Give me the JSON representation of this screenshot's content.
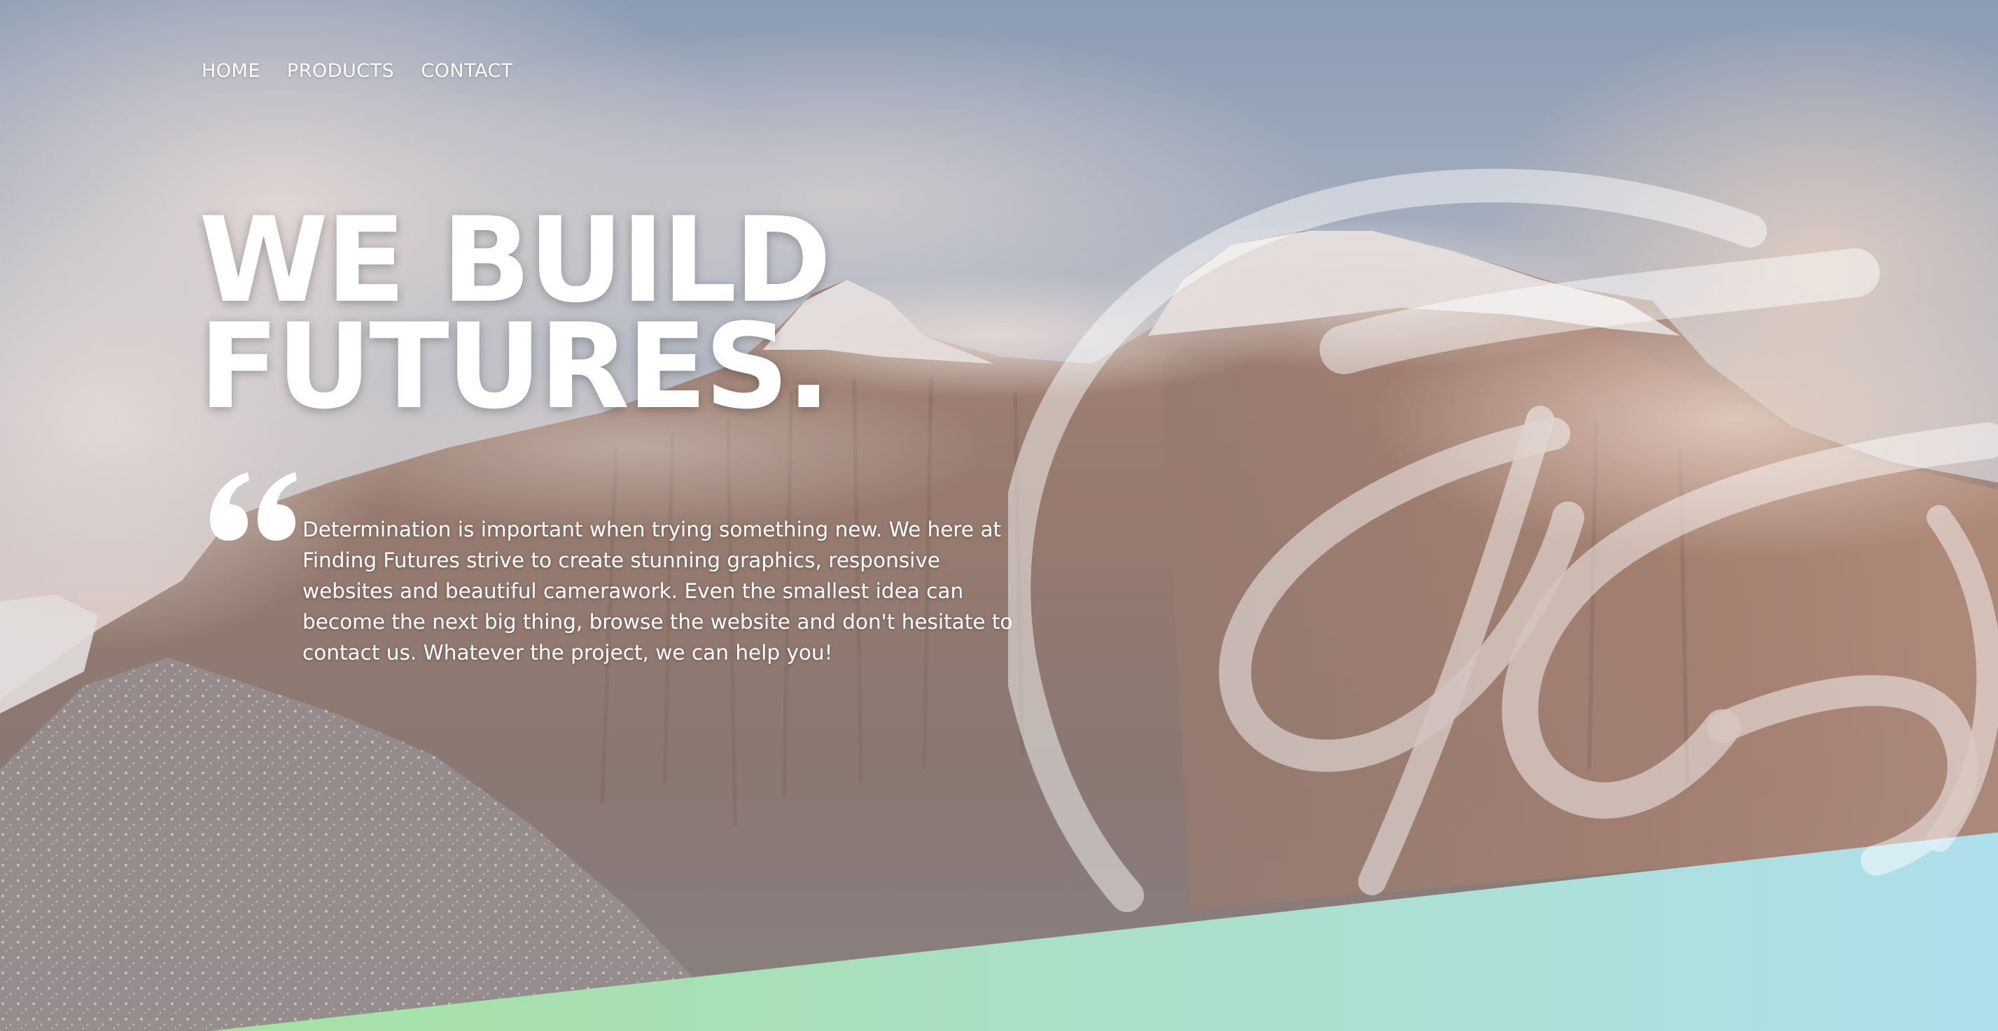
{
  "nav": {
    "items": [
      {
        "label": "HOME"
      },
      {
        "label": "PRODUCTS"
      },
      {
        "label": "CONTACT"
      }
    ]
  },
  "hero": {
    "headline_line1": "WE BUILD",
    "headline_line2": "FUTURES.",
    "quote_icon": "quote-mark-icon",
    "blurb": "Determination is important when trying something new. We here at Finding Futures strive to create stunning graphics, responsive websites and beautiful camerawork. Even the smallest idea can become the next big thing, browse the website and don't hesitate to contact us. Whatever the project, we can help you!"
  },
  "brand": {
    "logo_icon": "ff-monogram-logo",
    "accent_green": "#a8e0a6",
    "accent_blue": "#acdfea"
  }
}
